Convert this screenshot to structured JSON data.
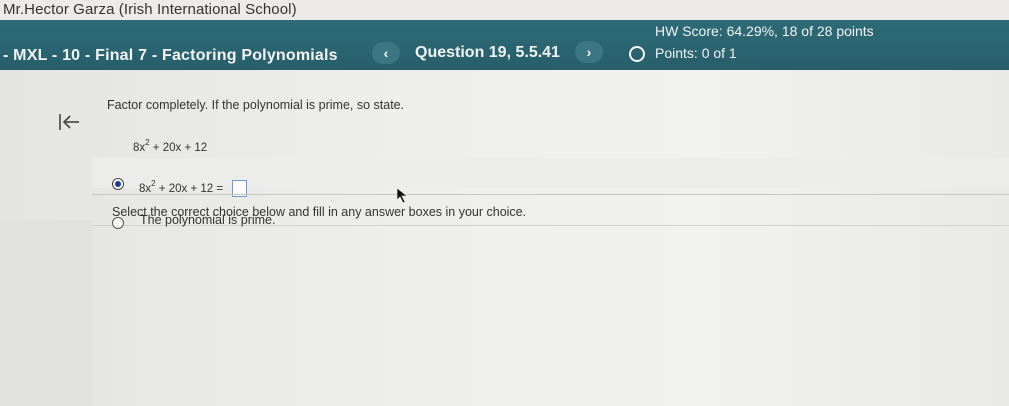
{
  "top": {
    "user": "Mr.Hector Garza (Irish International School)"
  },
  "header": {
    "course_title": "- MXL - 10 - Final 7 - Factoring Polynomials",
    "prev_icon": "‹",
    "question": "Question 19, 5.5.41",
    "next_icon": "›",
    "hw_score": "HW Score: 64.29%, 18 of 28 points",
    "points": "Points: 0 of 1"
  },
  "question": {
    "instruction": "Factor completely. If the polynomial is prime, so state.",
    "poly_coef": "8x",
    "poly_exp": "2",
    "poly_rest": " + 20x + 12",
    "more_label": "•••",
    "select_instruction": "Select the correct choice below and fill in any answer boxes in your choice.",
    "choices": [
      {
        "coef": "8x",
        "exp": "2",
        "rest": " + 20x + 12 =",
        "selected": true,
        "answer": ""
      },
      {
        "label": "The polynomial is prime.",
        "selected": false
      }
    ]
  },
  "icons": {
    "back": "back-to-start-arrow-icon",
    "cursor": "mouse-pointer-icon"
  },
  "colors": {
    "header_bg": "#2a6470",
    "radio_selected": "#1a3d8f",
    "answer_box_border": "#6d9cd2"
  }
}
